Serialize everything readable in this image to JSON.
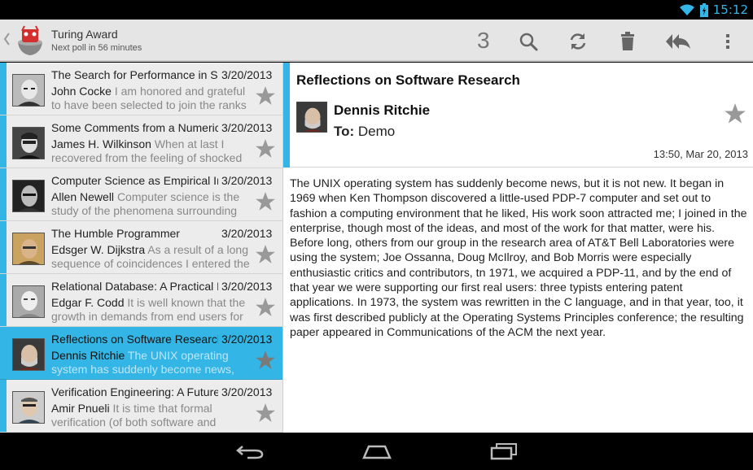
{
  "status": {
    "time": "15:12"
  },
  "actionbar": {
    "title": "Turing Award",
    "subtitle": "Next poll in 56 minutes",
    "count": "3",
    "icons": [
      "search-icon",
      "refresh-icon",
      "trash-icon",
      "reply-all-icon",
      "overflow-menu-icon"
    ]
  },
  "colors": {
    "accent": "#33b5e5",
    "list_bg": "#ececec",
    "actionbar_bg": "#e5e5e5"
  },
  "messages": [
    {
      "subject": "The Search for Performance in Scientific Processors",
      "date": "3/20/2013",
      "sender": "John Cocke",
      "preview": "I am honored and grateful to have been selected to join the ranks"
    },
    {
      "subject": "Some Comments from a Numerical Analyst",
      "date": "3/20/2013",
      "sender": "James H. Wilkinson",
      "preview": "When at last I recovered from the feeling of shocked"
    },
    {
      "subject": "Computer Science as Empirical Inquiry",
      "date": "3/20/2013",
      "sender": "Allen Newell",
      "preview": "Computer science is the study of the phenomena surrounding"
    },
    {
      "subject": "The Humble Programmer",
      "date": "3/20/2013",
      "sender": "Edsger W. Dijkstra",
      "preview": "As a result of a long sequence of coincidences I entered the"
    },
    {
      "subject": "Relational Database: A Practical Foundation",
      "date": "3/20/2013",
      "sender": "Edgar F. Codd",
      "preview": "It is well known that the growth in demands from end users for"
    },
    {
      "subject": "Reflections on Software Research",
      "date": "3/20/2013",
      "sender": "Dennis Ritchie",
      "preview": "The UNIX operating system has suddenly become news,"
    },
    {
      "subject": "Verification Engineering: A Future Profession",
      "date": "3/20/2013",
      "sender": "Amir Pnueli",
      "preview": "It is time that formal verification (of both software and"
    }
  ],
  "detail": {
    "subject": "Reflections on Software Research",
    "sender": "Dennis Ritchie",
    "to_label": "To:",
    "to": "Demo",
    "timestamp": "13:50, Mar 20, 2013",
    "body": "The UNIX operating system has suddenly become news, but it is not new. It began in 1969 when Ken Thompson discovered a little-used PDP-7 computer and set out to fashion a computing environment that he liked, His work soon attracted me; I joined in the enterprise, though most of the ideas, and most of the work for that matter, were his. Before long, others from our group in the research area of AT&T Bell Laboratories were using the system; Joe Ossanna, Doug McIlroy, and Bob Morris were especially enthusiastic critics and contributors, tn 1971, we acquired a PDP-11, and by the end of that year we were supporting our first real users: three typists entering patent applications. In 1973, the system was rewritten in the C language, and in that year, too, it was first described publicly at the Operating Systems Principles conference; the resulting paper appeared in Communications of the ACM the next year."
  },
  "navbar": {
    "icons": [
      "back-icon",
      "home-icon",
      "recent-apps-icon"
    ]
  }
}
